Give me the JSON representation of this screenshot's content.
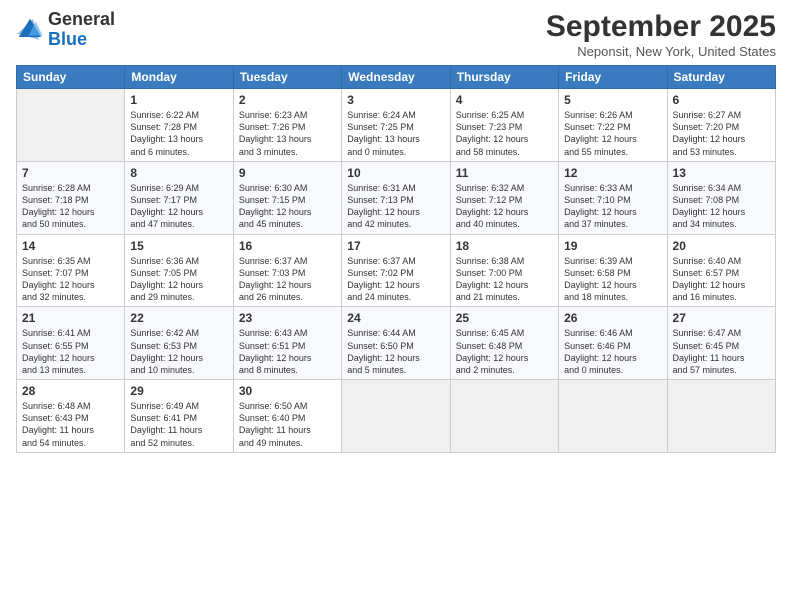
{
  "logo": {
    "general": "General",
    "blue": "Blue"
  },
  "header": {
    "month": "September 2025",
    "location": "Neponsit, New York, United States"
  },
  "days_of_week": [
    "Sunday",
    "Monday",
    "Tuesday",
    "Wednesday",
    "Thursday",
    "Friday",
    "Saturday"
  ],
  "weeks": [
    [
      {
        "day": "",
        "info": ""
      },
      {
        "day": "1",
        "info": "Sunrise: 6:22 AM\nSunset: 7:28 PM\nDaylight: 13 hours\nand 6 minutes."
      },
      {
        "day": "2",
        "info": "Sunrise: 6:23 AM\nSunset: 7:26 PM\nDaylight: 13 hours\nand 3 minutes."
      },
      {
        "day": "3",
        "info": "Sunrise: 6:24 AM\nSunset: 7:25 PM\nDaylight: 13 hours\nand 0 minutes."
      },
      {
        "day": "4",
        "info": "Sunrise: 6:25 AM\nSunset: 7:23 PM\nDaylight: 12 hours\nand 58 minutes."
      },
      {
        "day": "5",
        "info": "Sunrise: 6:26 AM\nSunset: 7:22 PM\nDaylight: 12 hours\nand 55 minutes."
      },
      {
        "day": "6",
        "info": "Sunrise: 6:27 AM\nSunset: 7:20 PM\nDaylight: 12 hours\nand 53 minutes."
      }
    ],
    [
      {
        "day": "7",
        "info": "Sunrise: 6:28 AM\nSunset: 7:18 PM\nDaylight: 12 hours\nand 50 minutes."
      },
      {
        "day": "8",
        "info": "Sunrise: 6:29 AM\nSunset: 7:17 PM\nDaylight: 12 hours\nand 47 minutes."
      },
      {
        "day": "9",
        "info": "Sunrise: 6:30 AM\nSunset: 7:15 PM\nDaylight: 12 hours\nand 45 minutes."
      },
      {
        "day": "10",
        "info": "Sunrise: 6:31 AM\nSunset: 7:13 PM\nDaylight: 12 hours\nand 42 minutes."
      },
      {
        "day": "11",
        "info": "Sunrise: 6:32 AM\nSunset: 7:12 PM\nDaylight: 12 hours\nand 40 minutes."
      },
      {
        "day": "12",
        "info": "Sunrise: 6:33 AM\nSunset: 7:10 PM\nDaylight: 12 hours\nand 37 minutes."
      },
      {
        "day": "13",
        "info": "Sunrise: 6:34 AM\nSunset: 7:08 PM\nDaylight: 12 hours\nand 34 minutes."
      }
    ],
    [
      {
        "day": "14",
        "info": "Sunrise: 6:35 AM\nSunset: 7:07 PM\nDaylight: 12 hours\nand 32 minutes."
      },
      {
        "day": "15",
        "info": "Sunrise: 6:36 AM\nSunset: 7:05 PM\nDaylight: 12 hours\nand 29 minutes."
      },
      {
        "day": "16",
        "info": "Sunrise: 6:37 AM\nSunset: 7:03 PM\nDaylight: 12 hours\nand 26 minutes."
      },
      {
        "day": "17",
        "info": "Sunrise: 6:37 AM\nSunset: 7:02 PM\nDaylight: 12 hours\nand 24 minutes."
      },
      {
        "day": "18",
        "info": "Sunrise: 6:38 AM\nSunset: 7:00 PM\nDaylight: 12 hours\nand 21 minutes."
      },
      {
        "day": "19",
        "info": "Sunrise: 6:39 AM\nSunset: 6:58 PM\nDaylight: 12 hours\nand 18 minutes."
      },
      {
        "day": "20",
        "info": "Sunrise: 6:40 AM\nSunset: 6:57 PM\nDaylight: 12 hours\nand 16 minutes."
      }
    ],
    [
      {
        "day": "21",
        "info": "Sunrise: 6:41 AM\nSunset: 6:55 PM\nDaylight: 12 hours\nand 13 minutes."
      },
      {
        "day": "22",
        "info": "Sunrise: 6:42 AM\nSunset: 6:53 PM\nDaylight: 12 hours\nand 10 minutes."
      },
      {
        "day": "23",
        "info": "Sunrise: 6:43 AM\nSunset: 6:51 PM\nDaylight: 12 hours\nand 8 minutes."
      },
      {
        "day": "24",
        "info": "Sunrise: 6:44 AM\nSunset: 6:50 PM\nDaylight: 12 hours\nand 5 minutes."
      },
      {
        "day": "25",
        "info": "Sunrise: 6:45 AM\nSunset: 6:48 PM\nDaylight: 12 hours\nand 2 minutes."
      },
      {
        "day": "26",
        "info": "Sunrise: 6:46 AM\nSunset: 6:46 PM\nDaylight: 12 hours\nand 0 minutes."
      },
      {
        "day": "27",
        "info": "Sunrise: 6:47 AM\nSunset: 6:45 PM\nDaylight: 11 hours\nand 57 minutes."
      }
    ],
    [
      {
        "day": "28",
        "info": "Sunrise: 6:48 AM\nSunset: 6:43 PM\nDaylight: 11 hours\nand 54 minutes."
      },
      {
        "day": "29",
        "info": "Sunrise: 6:49 AM\nSunset: 6:41 PM\nDaylight: 11 hours\nand 52 minutes."
      },
      {
        "day": "30",
        "info": "Sunrise: 6:50 AM\nSunset: 6:40 PM\nDaylight: 11 hours\nand 49 minutes."
      },
      {
        "day": "",
        "info": ""
      },
      {
        "day": "",
        "info": ""
      },
      {
        "day": "",
        "info": ""
      },
      {
        "day": "",
        "info": ""
      }
    ]
  ]
}
